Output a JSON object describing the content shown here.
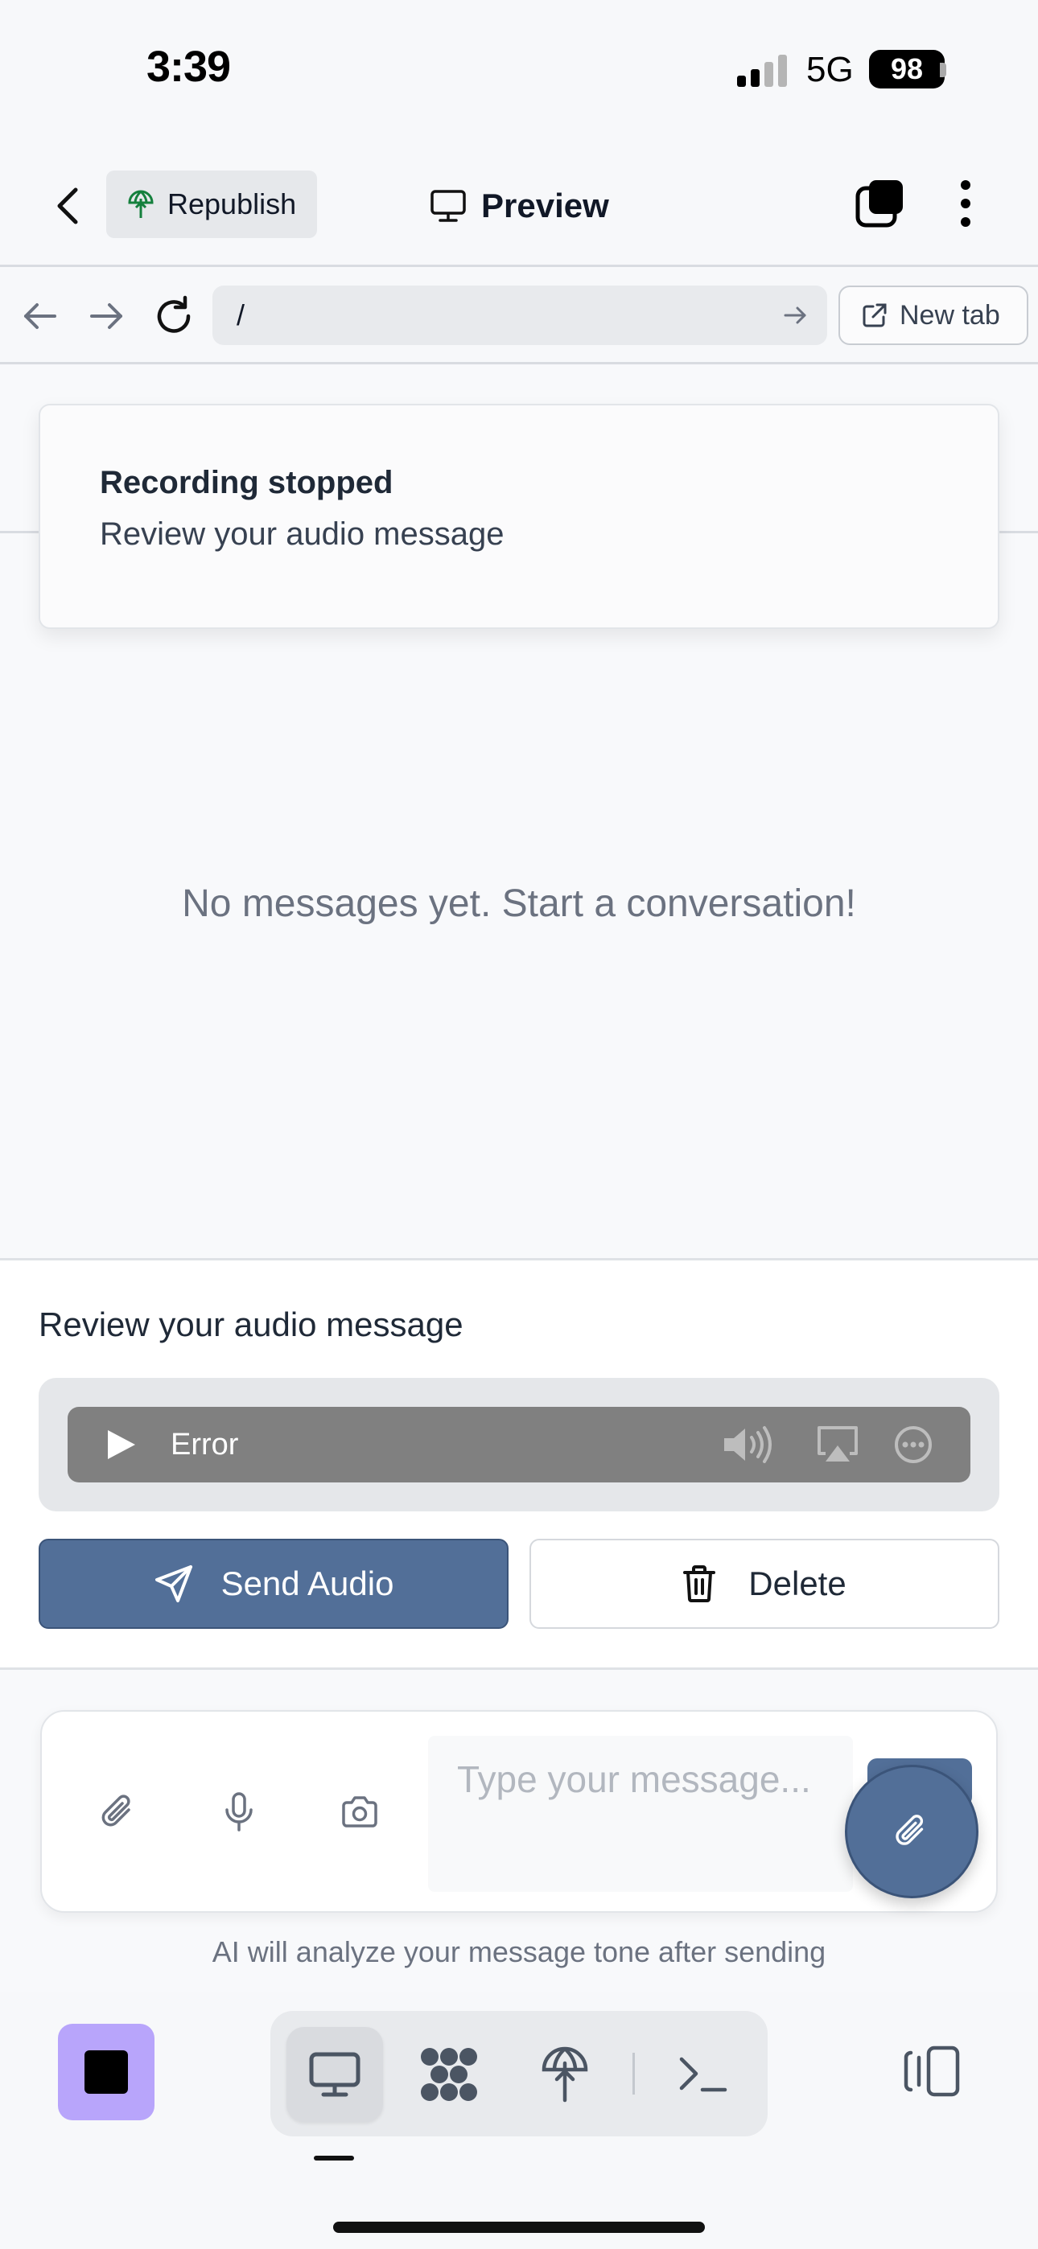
{
  "status_bar": {
    "time": "3:39",
    "network": "5G",
    "battery": "98"
  },
  "header": {
    "republish_label": "Republish",
    "title": "Preview"
  },
  "browser": {
    "url": "/",
    "new_tab_label": "New tab"
  },
  "toast": {
    "title": "Recording stopped",
    "description": "Review your audio message"
  },
  "content": {
    "empty_message": "No messages yet. Start a conversation!"
  },
  "review": {
    "title": "Review your audio message",
    "player_status": "Error",
    "send_label": "Send Audio",
    "delete_label": "Delete"
  },
  "composer": {
    "placeholder": "Type your message...",
    "hint": "AI will analyze your message tone after sending"
  },
  "toolbar": {
    "active_tool": "desktop-preview"
  },
  "colors": {
    "accent": "#526f98",
    "stop_button": "#b8a5fb",
    "player": "#808080"
  }
}
